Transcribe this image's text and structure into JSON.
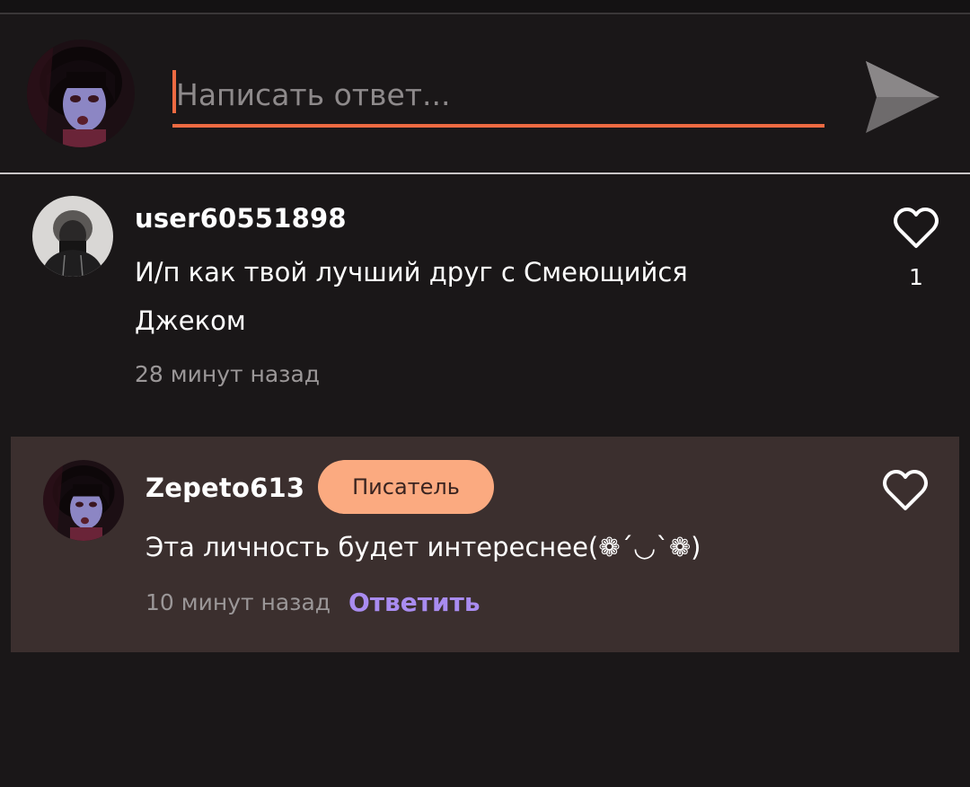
{
  "composer": {
    "placeholder": "Написать ответ...",
    "value": ""
  },
  "comments": [
    {
      "username": "user60551898",
      "text": "И/п как твой лучший друг с Смеющийся Джеком",
      "time": "28 минут назад",
      "likes": "1"
    },
    {
      "username": "Zepeto613",
      "badge": "Писатель",
      "text": "Эта личность будет интереснее(❁´◡`❁)",
      "time": "10 минут назад",
      "reply_label": "Ответить"
    }
  ],
  "colors": {
    "accent": "#ee6a42",
    "badge": "#fbaa80",
    "reply_link": "#a98cf0",
    "highlight_bg": "#3b2f2e"
  },
  "icons": [
    "send-icon",
    "heart-icon"
  ]
}
